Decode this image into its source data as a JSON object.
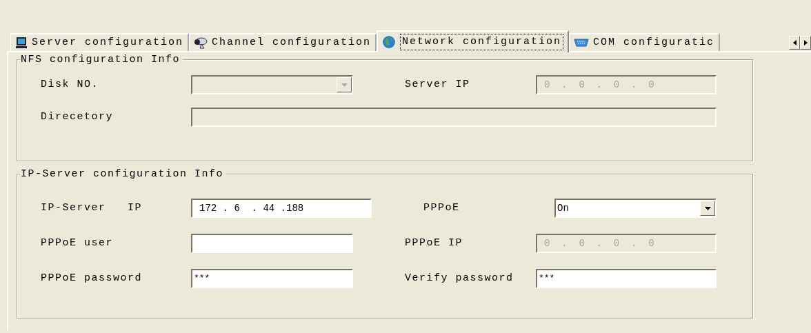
{
  "tabs": [
    {
      "label": "Server configuration",
      "selected": false
    },
    {
      "label": "Channel configuration",
      "selected": false
    },
    {
      "label": "Network configuration",
      "selected": true
    },
    {
      "label": "COM configuratic",
      "selected": false
    }
  ],
  "groups": [
    {
      "title": "NFS configuration Info",
      "rows": [
        [
          {
            "label": "Disk NO.",
            "field": {
              "kind": "combo",
              "disabled": true
            }
          },
          {
            "label": "Server IP",
            "field": {
              "kind": "ip",
              "value": "0  .  0  .  0  .  0",
              "disabled": true
            }
          }
        ],
        [
          {
            "label": "Direcetory",
            "field": {
              "kind": "text",
              "disabled": true
            }
          }
        ]
      ]
    },
    {
      "title": "IP-Server configuration Info",
      "rows": [
        [
          {
            "label": "IP-Server   IP",
            "field": {
              "kind": "ip",
              "value": "172 . 6  . 44 .188",
              "disabled": false
            }
          },
          {
            "label": "PPPoE",
            "field": {
              "kind": "combo",
              "value": "On",
              "disabled": false
            }
          }
        ],
        [
          {
            "label": "PPPoE user",
            "field": {
              "kind": "text",
              "disabled": false
            }
          },
          {
            "label": "PPPoE IP",
            "field": {
              "kind": "ip",
              "value": "0  .  0  .  0  .  0",
              "disabled": true
            }
          }
        ],
        [
          {
            "label": "PPPoE password",
            "field": {
              "kind": "text",
              "value": "***",
              "disabled": false
            }
          },
          {
            "label": "Verify password",
            "field": {
              "kind": "text",
              "value": "***",
              "disabled": false
            }
          }
        ]
      ]
    }
  ]
}
